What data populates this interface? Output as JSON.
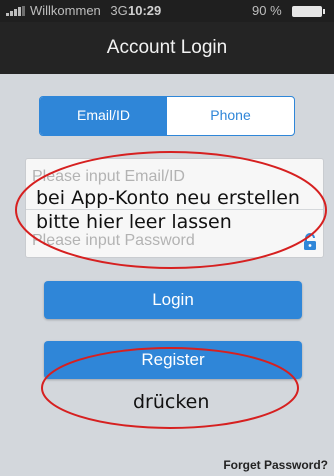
{
  "status_bar": {
    "carrier": "Willkommen",
    "network": "3G",
    "time": "10:29",
    "battery": "90 %"
  },
  "header": {
    "title": "Account Login"
  },
  "tabs": [
    {
      "label": "Email/ID",
      "active": true
    },
    {
      "label": "Phone",
      "active": false
    }
  ],
  "form": {
    "email_placeholder": "Please input Email/ID",
    "password_placeholder": "Please input Password",
    "login_label": "Login",
    "register_label": "Register",
    "forgot_label": "Forget Password?"
  },
  "annotations": {
    "note_1_line_1": "bei App-Konto neu erstellen",
    "note_1_line_2": "bitte hier leer lassen",
    "note_2": "drücken"
  },
  "colors": {
    "accent": "#2f86d8",
    "annotation_ellipse": "#d62020"
  },
  "icons": {
    "signal": "signal-icon",
    "battery": "battery-icon",
    "lock": "lock-icon"
  }
}
